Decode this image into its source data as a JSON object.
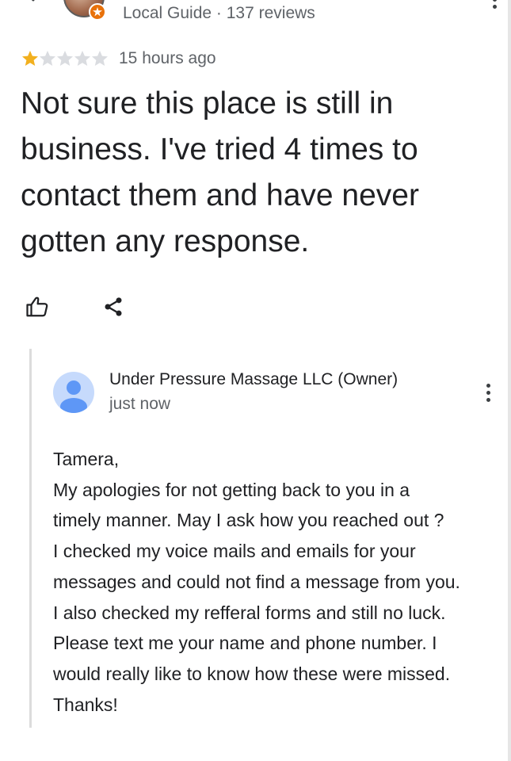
{
  "review": {
    "reviewer_meta": "Local Guide · 137 reviews",
    "rating": 1,
    "rating_max": 5,
    "time_ago": "15 hours ago",
    "text": "Not sure this place is still in\nbusiness.  I've tried 4 times to\ncontact them and have never\ngotten any response."
  },
  "actions": {
    "like_icon": "thumb-up-icon",
    "share_icon": "share-icon"
  },
  "owner_reply": {
    "name": "Under Pressure Massage LLC (Owner)",
    "time": "just now",
    "text": "Tamera,\nMy apologies for not getting back to you in a\ntimely manner. May I ask how you reached out ?\nI checked my voice mails and emails for your\nmessages and could not find a message from you.\nI also checked my refferal forms and still no luck.\nPlease text me your name and phone number. I\nwould really like to know how these were missed.\nThanks!"
  },
  "colors": {
    "star_filled": "#f2b01e",
    "star_empty": "#dadce0",
    "secondary_text": "#5f6368",
    "badge": "#e8710a",
    "owner_avatar_bg": "#c6dafc",
    "owner_avatar_fg": "#5e97f6"
  }
}
